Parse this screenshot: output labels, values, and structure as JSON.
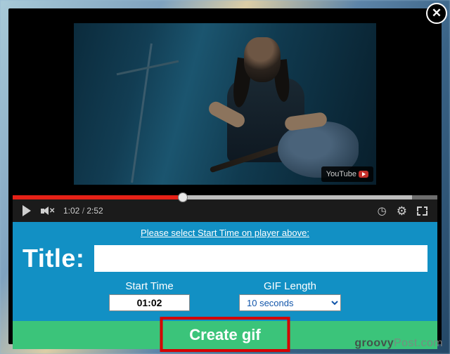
{
  "player": {
    "current_time": "1:02",
    "duration": "2:52",
    "youtube_badge": "YouTube"
  },
  "panel": {
    "instruction": "Please select Start Time on player above:",
    "title_label": "Title:",
    "title_value": "",
    "start_time_label": "Start Time",
    "start_time_value": "01:02",
    "gif_length_label": "GIF Length",
    "gif_length_value": "10 seconds"
  },
  "actions": {
    "create_label": "Create gif"
  },
  "watermark": {
    "brand": "groovy",
    "suffix": "Post.com"
  }
}
